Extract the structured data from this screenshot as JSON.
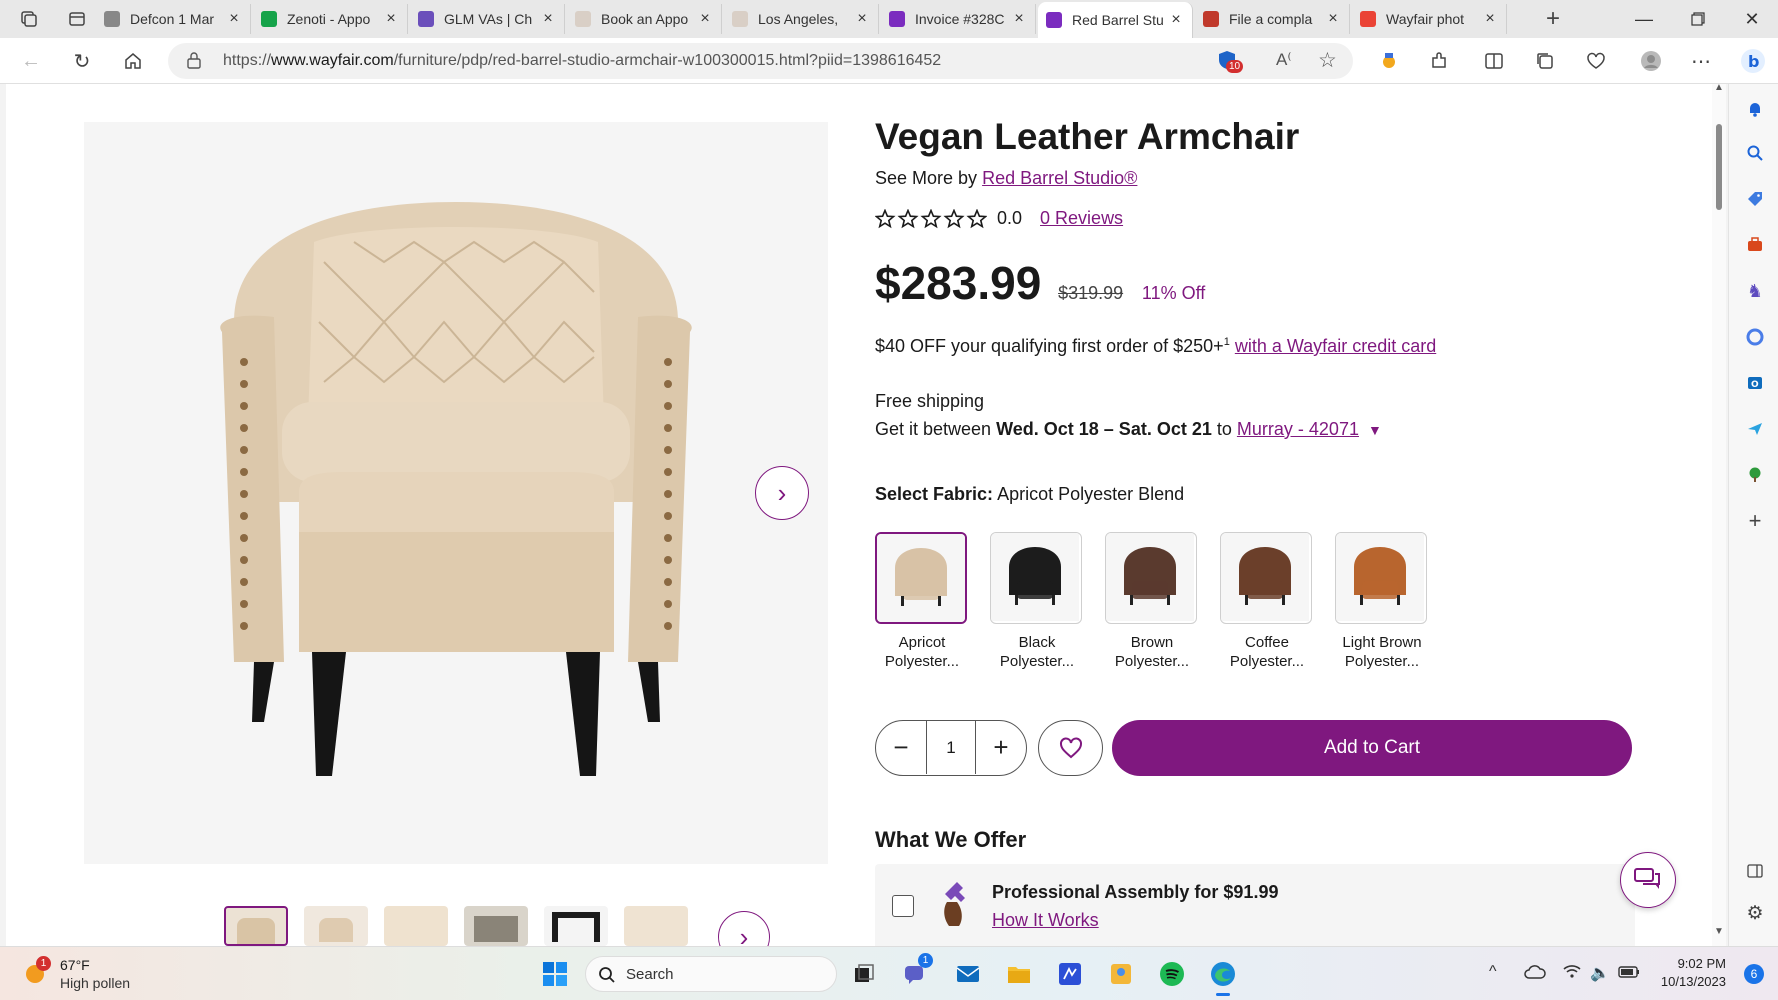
{
  "browser": {
    "tabs": [
      {
        "label": "Defcon 1 Mar",
        "icon_color": "#888888",
        "active": false
      },
      {
        "label": "Zenoti - Appo",
        "icon_color": "#16a34a",
        "active": false
      },
      {
        "label": "GLM VAs | Ch",
        "icon_color": "#6b4fbb",
        "active": false
      },
      {
        "label": "Book an Appo",
        "icon_color": "#d9cfc6",
        "active": false
      },
      {
        "label": "Los Angeles, ",
        "icon_color": "#d9cfc6",
        "active": false
      },
      {
        "label": "Invoice #328C",
        "icon_color": "#7b2cbf",
        "active": false
      },
      {
        "label": "Red Barrel Stu",
        "icon_color": "#7b2cbf",
        "active": true
      },
      {
        "label": "File a compla",
        "icon_color": "#c0392b",
        "active": false
      },
      {
        "label": "Wayfair phot",
        "icon_color": "#ea4335",
        "active": false
      }
    ],
    "url_prefix": "https://",
    "url_domain": "www.wayfair.com",
    "url_path": "/furniture/pdp/red-barrel-studio-armchair-w100300015.html?piid=1398616452",
    "extension_badge": "10"
  },
  "product": {
    "title": "Vegan Leather Armchair",
    "see_more_prefix": "See More by",
    "brand": "Red Barrel Studio®",
    "rating": "0.0",
    "reviews_link": "0 Reviews",
    "price": "$283.99",
    "original_price": "$319.99",
    "discount": "11% Off",
    "promo_text": "$40 OFF your qualifying first order of $250+",
    "promo_sup": "1",
    "promo_link": "with a Wayfair credit card",
    "shipping_label": "Free shipping",
    "delivery_prefix": "Get it between",
    "delivery_dates": "Wed. Oct 18 – Sat. Oct 21",
    "delivery_to": "to",
    "delivery_location": "Murray - 42071",
    "fabric_label": "Select Fabric:",
    "fabric_value": "Apricot Polyester Blend",
    "swatches": [
      {
        "line1": "Apricot",
        "line2": "Polyester...",
        "color": "#d8c2a6",
        "selected": true
      },
      {
        "line1": "Black",
        "line2": "Polyester...",
        "color": "#1c1c1c",
        "selected": false
      },
      {
        "line1": "Brown",
        "line2": "Polyester...",
        "color": "#5a3a2e",
        "selected": false
      },
      {
        "line1": "Coffee",
        "line2": "Polyester...",
        "color": "#6b3f2a",
        "selected": false
      },
      {
        "line1": "Light Brown",
        "line2": "Polyester...",
        "color": "#b8652e",
        "selected": false
      }
    ],
    "quantity": "1",
    "add_to_cart": "Add to Cart",
    "offer_heading": "What We Offer",
    "assembly_label": "Professional Assembly for $91.99",
    "assembly_link": "How It Works"
  },
  "taskbar": {
    "weather_temp": "67°F",
    "weather_desc": "High pollen",
    "weather_badge": "1",
    "search_placeholder": "Search",
    "teams_badge": "1",
    "time": "9:02 PM",
    "date": "10/13/2023",
    "notif_count": "6"
  },
  "colors": {
    "accent": "#7f187f",
    "chair": "#e6d6bf"
  }
}
